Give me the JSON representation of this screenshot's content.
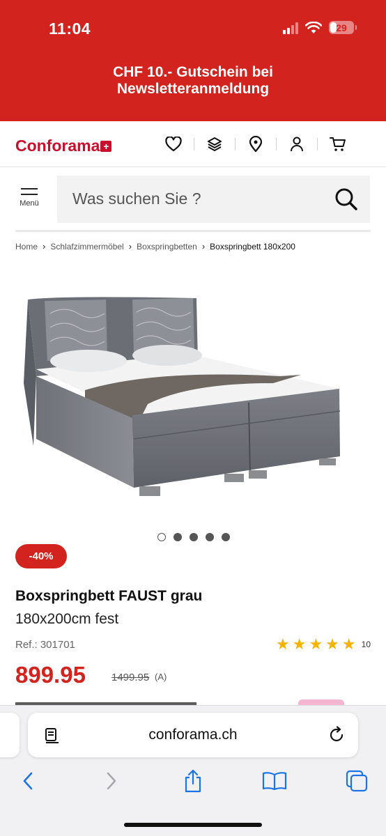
{
  "status_bar": {
    "time": "11:04",
    "battery": "29",
    "battery_level": 0.29
  },
  "banner": {
    "line1": "CHF 10.- Gutschein bei",
    "line2": "Newsletteranmeldung"
  },
  "header": {
    "logo": "Conforama",
    "icons": [
      "heart-icon",
      "layers-icon",
      "location-pin-icon",
      "user-icon",
      "cart-icon"
    ]
  },
  "menu": {
    "label": "Menü"
  },
  "search": {
    "placeholder": "Was suchen Sie ?"
  },
  "breadcrumb": {
    "items": [
      "Home",
      "Schlafzimmermöbel",
      "Boxspringbetten"
    ],
    "current": "Boxspringbett 180x200"
  },
  "gallery": {
    "total": 5,
    "active_index": 0
  },
  "product": {
    "discount": "-40%",
    "title": "Boxspringbett FAUST grau",
    "subtitle": "180x200cm fest",
    "ref": "Ref.: 301701",
    "rating": 5,
    "rating_count": "10",
    "price": "899.95",
    "old_price": "1499.95",
    "old_price_suffix": "(A)"
  },
  "browser": {
    "url": "conforama.ch",
    "toolbar_icons": [
      "back-icon",
      "forward-icon",
      "share-icon",
      "bookmarks-icon",
      "tabs-icon"
    ]
  },
  "colors": {
    "brand_red": "#d3231f",
    "star": "#f5b301"
  }
}
